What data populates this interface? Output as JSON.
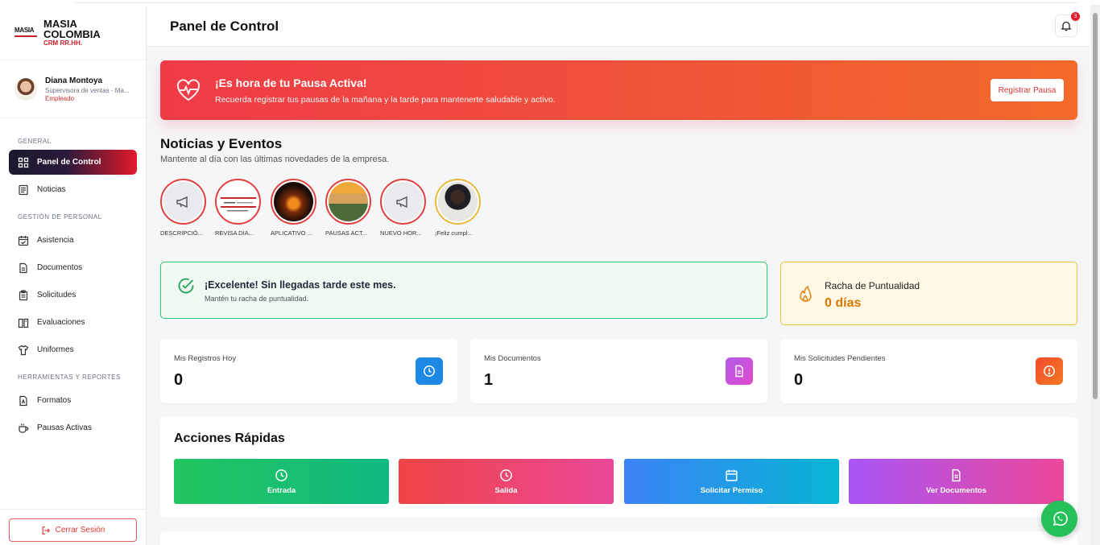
{
  "brand": {
    "logo_text": "MASIA",
    "name_line1": "MASIA",
    "name_line2": "COLOMBIA",
    "subtitle": "CRM RR.HH."
  },
  "profile": {
    "name": "Diana Montoya",
    "role": "Supervisora de ventas - Ma...",
    "type": "Empleado"
  },
  "sidebar": {
    "sections": [
      "General",
      "Gestión de Personal",
      "Herramientas y Reportes"
    ],
    "items": [
      {
        "label": "Panel de Control",
        "icon": "grid-icon",
        "active": true
      },
      {
        "label": "Noticias",
        "icon": "newspaper-icon"
      },
      {
        "label": "Asistencia",
        "icon": "calendar-check-icon"
      },
      {
        "label": "Documentos",
        "icon": "document-icon"
      },
      {
        "label": "Solicitudes",
        "icon": "clipboard-icon"
      },
      {
        "label": "Evaluaciones",
        "icon": "book-open-icon"
      },
      {
        "label": "Uniformes",
        "icon": "shirt-icon"
      },
      {
        "label": "Formatos",
        "icon": "file-format-icon"
      },
      {
        "label": "Pausas Activas",
        "icon": "cup-icon"
      }
    ],
    "logout": "Cerrar Sesión"
  },
  "header": {
    "title": "Panel de Control",
    "notifications": "3"
  },
  "banner": {
    "title": "¡Es hora de tu Pausa Activa!",
    "text": "Recuerda registrar tus pausas de la mañana y la tarde para mantenerte saludable y activo.",
    "button": "Registrar Pausa"
  },
  "news": {
    "title": "Noticias y Eventos",
    "subtitle": "Mantente al día con las últimas novedades de la empresa.",
    "stories": [
      {
        "caption": "DESCRIPCIÓ...",
        "kind": "megaphone-icon"
      },
      {
        "caption": "REVISA DIA...",
        "kind": "document-thumb"
      },
      {
        "caption": "APLICATIVO ...",
        "kind": "fire-thumb"
      },
      {
        "caption": "PAUSAS ACT...",
        "kind": "worker-thumb"
      },
      {
        "caption": "NUEVO HOR...",
        "kind": "megaphone-icon"
      },
      {
        "caption": "¡Feliz cumpl...",
        "kind": "portrait-thumb"
      }
    ]
  },
  "punctuality": {
    "title": "¡Excelente! Sin llegadas tarde este mes.",
    "subtitle": "Mantén tu racha de puntualidad."
  },
  "streak": {
    "title": "Racha de Puntualidad",
    "value": "0 días"
  },
  "stats": [
    {
      "label": "Mis Registros Hoy",
      "value": "0",
      "color": "#1e88e5"
    },
    {
      "label": "Mis Documentos",
      "value": "1",
      "color": "#c84de0"
    },
    {
      "label": "Mis Solicitudes Pendientes",
      "value": "0",
      "color": "#f0502e"
    }
  ],
  "quick": {
    "title": "Acciones Rápidas",
    "buttons": [
      {
        "label": "Entrada",
        "icon": "clock-icon"
      },
      {
        "label": "Salida",
        "icon": "clock-icon"
      },
      {
        "label": "Solicitar Permiso",
        "icon": "calendar-icon"
      },
      {
        "label": "Ver Documentos",
        "icon": "document-icon"
      }
    ]
  },
  "colors": {
    "accent": "#e11d2f",
    "success": "#34c77b",
    "warning": "#d97706",
    "whatsapp": "#25c05a"
  }
}
